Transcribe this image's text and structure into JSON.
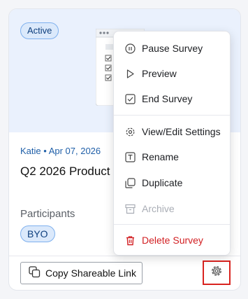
{
  "card": {
    "status_badge": "Active",
    "meta": "Katie • Apr 07, 2026",
    "title": "Q2 2026 Product",
    "participants_label": "Participants",
    "participants_badge": "BYO",
    "copy_link_label": "Copy Shareable Link"
  },
  "menu": {
    "items": [
      {
        "label": "Pause Survey",
        "icon": "pause-icon"
      },
      {
        "label": "Preview",
        "icon": "play-icon"
      },
      {
        "label": "End Survey",
        "icon": "check-square-icon"
      },
      {
        "label": "View/Edit Settings",
        "icon": "gear-icon"
      },
      {
        "label": "Rename",
        "icon": "text-icon"
      },
      {
        "label": "Duplicate",
        "icon": "duplicate-icon"
      },
      {
        "label": "Archive",
        "icon": "archive-icon",
        "disabled": true
      },
      {
        "label": "Delete Survey",
        "icon": "trash-icon",
        "danger": true
      }
    ]
  },
  "colors": {
    "accent": "#1f5fa8",
    "danger": "#d21f22",
    "highlight_outline": "#d9231f",
    "badge_border": "#7eb0ee"
  }
}
